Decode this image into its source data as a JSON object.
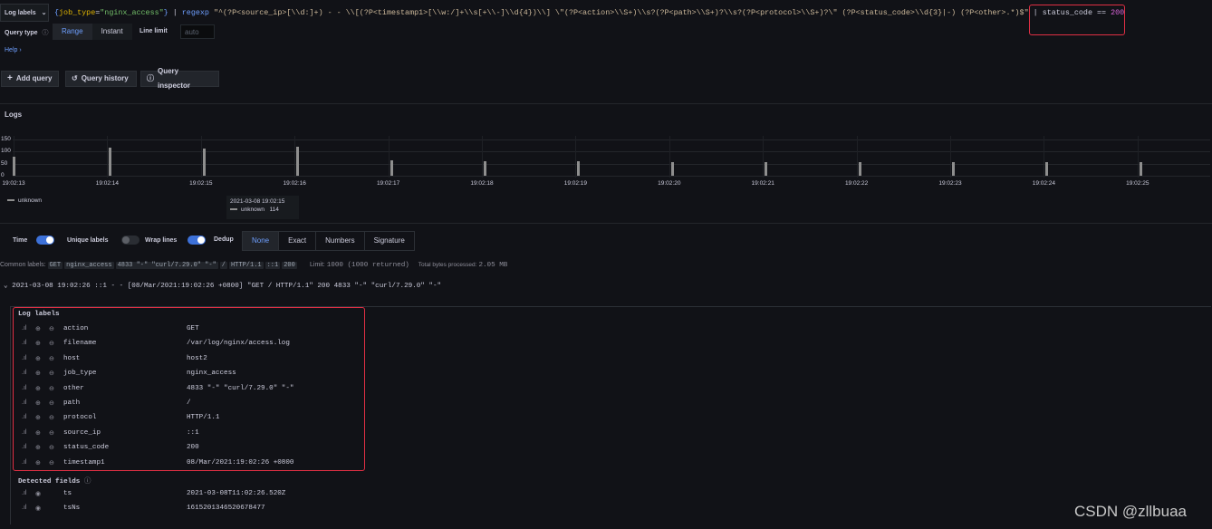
{
  "query": {
    "label_button": "Log labels",
    "tokens": {
      "open": "{",
      "key": "job_type",
      "eq": "=",
      "str": "\"nginx_access\"",
      "close": "}",
      "pipe1": "|",
      "kw": "regexp",
      "regex": "\"^(?P<source_ip>[\\\\d:]+) - - \\\\[(?P<timestamp1>[\\\\w:/]+\\\\s[+\\\\-]\\\\d{4})\\\\] \\\"(?P<action>\\\\S+)\\\\s?(?P<path>\\\\S+)?\\\\s?(?P<protocol>\\\\S+)?\\\" (?P<status_code>\\\\d{3}|-) (?P<other>.*)$\"",
      "pipe2": "|",
      "filter_id": "status_code",
      "filter_op": "==",
      "filter_val": "200"
    }
  },
  "options": {
    "query_type_label": "Query type",
    "query_types": [
      "Range",
      "Instant"
    ],
    "selected_query_type": "Range",
    "line_limit_label": "Line limit",
    "line_limit_placeholder": "auto",
    "help": "Help"
  },
  "toolbar": {
    "add_query": "Add query",
    "query_history": "Query history",
    "query_inspector": "Query inspector"
  },
  "logs_title": "Logs",
  "chart_data": {
    "type": "bar",
    "yticks": [
      150,
      100,
      50,
      0
    ],
    "ylim": [
      0,
      150
    ],
    "xticks": [
      "19:02:13",
      "19:02:14",
      "19:02:15",
      "19:02:16",
      "19:02:17",
      "19:02:18",
      "19:02:19",
      "19:02:20",
      "19:02:21",
      "19:02:22",
      "19:02:23",
      "19:02:24",
      "19:02:25"
    ],
    "series": [
      {
        "name": "unknown",
        "x": [
          "19:02:13",
          "19:02:14",
          "19:02:15",
          "19:02:16",
          "19:02:17",
          "19:02:18",
          "19:02:19",
          "19:02:20",
          "19:02:21",
          "19:02:22",
          "19:02:23",
          "19:02:24",
          "19:02:25"
        ],
        "values": [
          80,
          118,
          114,
          120,
          62,
          60,
          59,
          58,
          57,
          58,
          58,
          57,
          58
        ]
      }
    ],
    "legend": [
      "unknown"
    ],
    "tooltip": {
      "time": "2021-03-08 19:02:15",
      "series": "unknown",
      "value": "114"
    }
  },
  "display": {
    "time_label": "Time",
    "time_on": true,
    "unique_label": "Unique labels",
    "unique_on": false,
    "wrap_label": "Wrap lines",
    "wrap_on": true,
    "dedup_label": "Dedup",
    "dedup_options": [
      "None",
      "Exact",
      "Numbers",
      "Signature"
    ],
    "dedup_selected": "None"
  },
  "meta": {
    "common_labels_label": "Common labels:",
    "common_labels": [
      "GET",
      "nginx_access",
      "4833 \"-\" \"curl/7.29.0\" \"-\"",
      "/",
      "HTTP/1.1",
      "::1",
      "200"
    ],
    "limit_label": "Limit:",
    "limit_value": "1000 (1000 returned)",
    "bytes_label": "Total bytes processed:",
    "bytes_value": "2.05 MB"
  },
  "log_entry": {
    "chevron": "⌄",
    "time": "2021-03-08 19:02:26",
    "line": "::1 - - [08/Mar/2021:19:02:26 +0800] \"GET / HTTP/1.1\" 200 4833 \"-\" \"curl/7.29.0\" \"-\""
  },
  "log_labels": {
    "title": "Log labels",
    "rows": [
      {
        "key": "action",
        "value": "GET"
      },
      {
        "key": "filename",
        "value": "/var/log/nginx/access.log"
      },
      {
        "key": "host",
        "value": "host2"
      },
      {
        "key": "job_type",
        "value": "nginx_access"
      },
      {
        "key": "other",
        "value": "4833 \"-\" \"curl/7.29.0\" \"-\""
      },
      {
        "key": "path",
        "value": "/"
      },
      {
        "key": "protocol",
        "value": "HTTP/1.1"
      },
      {
        "key": "source_ip",
        "value": "::1"
      },
      {
        "key": "status_code",
        "value": "200"
      },
      {
        "key": "timestamp1",
        "value": "08/Mar/2021:19:02:26 +0800"
      }
    ]
  },
  "detected_fields": {
    "title": "Detected fields",
    "rows": [
      {
        "key": "ts",
        "value": "2021-03-08T11:02:26.520Z"
      },
      {
        "key": "tsNs",
        "value": "1615201346520678477"
      }
    ]
  },
  "colors": {
    "accent": "#6e9fff",
    "highlight": "#e02f44",
    "bar": "#8e8e8e"
  },
  "watermark": "CSDN @zllbuaa"
}
